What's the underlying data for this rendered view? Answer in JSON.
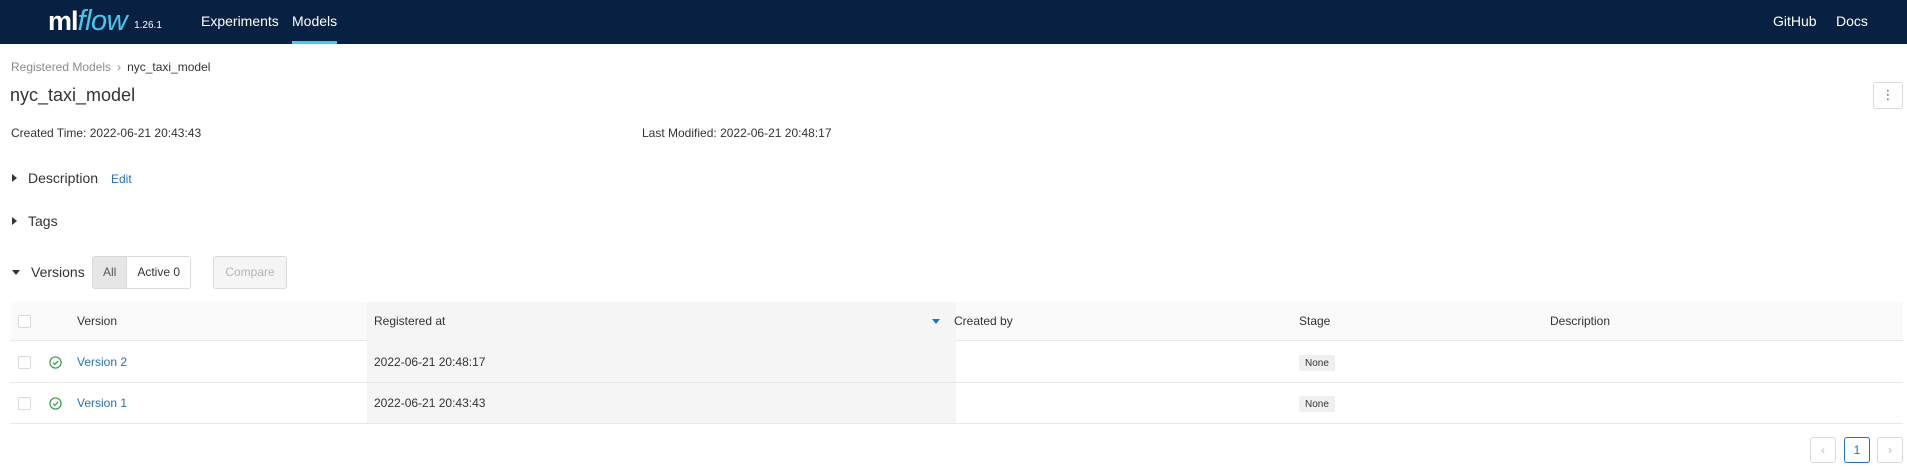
{
  "app": {
    "logo_ml": "ml",
    "logo_flow": "flow",
    "version": "1.26.1"
  },
  "nav": {
    "experiments": "Experiments",
    "models": "Models",
    "github": "GitHub",
    "docs": "Docs"
  },
  "breadcrumb": {
    "root": "Registered Models",
    "separator": "›",
    "current": "nyc_taxi_model"
  },
  "page": {
    "title": "nyc_taxi_model",
    "more_label": "⋮"
  },
  "meta": {
    "created_label": "Created Time:",
    "created_value": "2022-06-21 20:43:43",
    "modified_label": "Last Modified:",
    "modified_value": "2022-06-21 20:48:17"
  },
  "sections": {
    "description": "Description",
    "edit": "Edit",
    "tags": "Tags",
    "versions": "Versions"
  },
  "filters": {
    "all": "All",
    "active": "Active 0",
    "compare": "Compare"
  },
  "table": {
    "headers": {
      "version": "Version",
      "registered_at": "Registered at",
      "created_by": "Created by",
      "stage": "Stage",
      "description": "Description"
    },
    "rows": [
      {
        "version": "Version 2",
        "registered_at": "2022-06-21 20:48:17",
        "created_by": "",
        "stage": "None",
        "description": ""
      },
      {
        "version": "Version 1",
        "registered_at": "2022-06-21 20:43:43",
        "created_by": "",
        "stage": "None",
        "description": ""
      }
    ]
  },
  "pagination": {
    "prev": "‹",
    "current": "1",
    "next": "›"
  },
  "colors": {
    "nav_bg": "#082142",
    "accent": "#43C9ED",
    "link": "#2272b4",
    "status_ok": "#3a9b4a"
  }
}
